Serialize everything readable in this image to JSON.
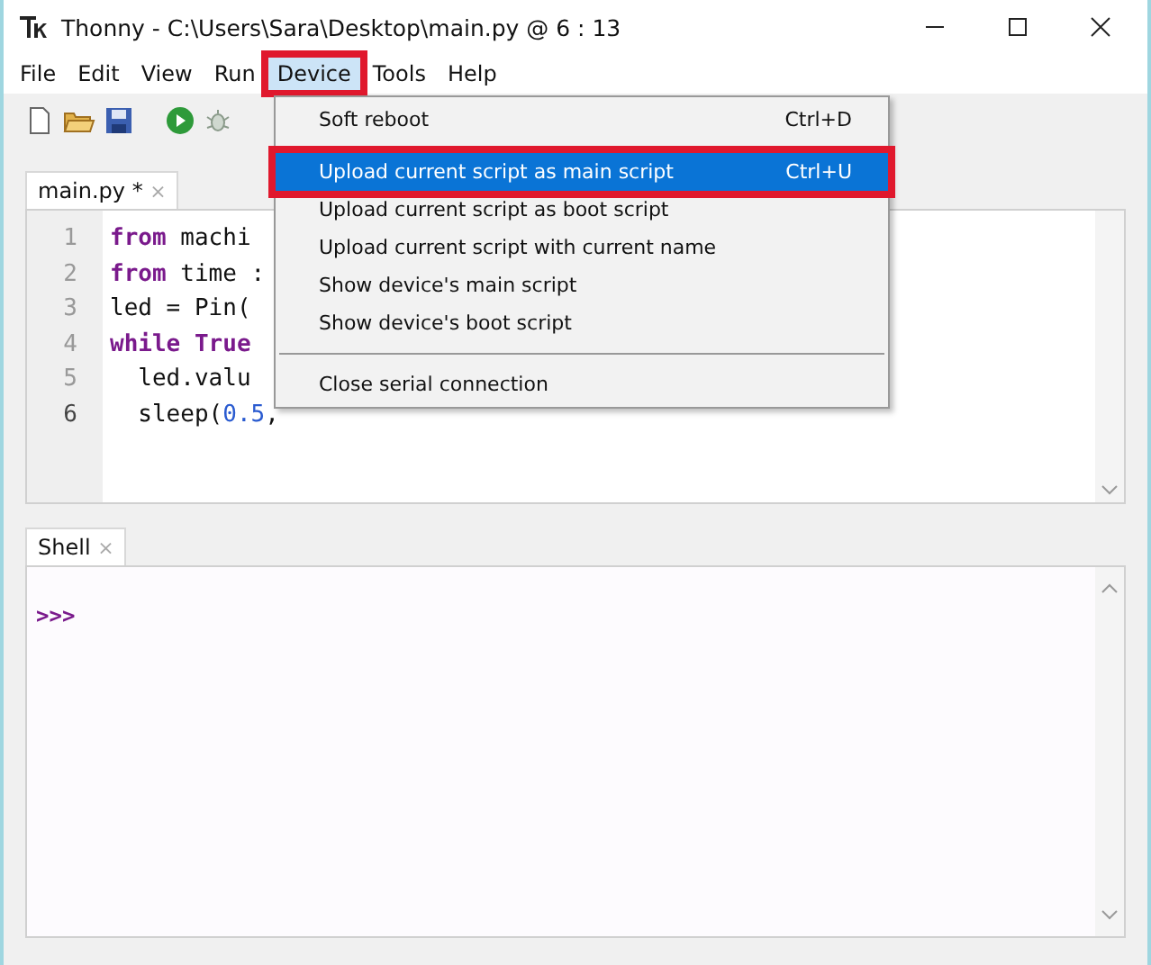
{
  "window": {
    "title": "Thonny  -  C:\\Users\\Sara\\Desktop\\main.py  @  6 : 13"
  },
  "menu_bar": [
    {
      "label": "File",
      "selected": false,
      "annotated": false
    },
    {
      "label": "Edit",
      "selected": false,
      "annotated": false
    },
    {
      "label": "View",
      "selected": false,
      "annotated": false
    },
    {
      "label": "Run",
      "selected": false,
      "annotated": false
    },
    {
      "label": "Device",
      "selected": true,
      "annotated": true
    },
    {
      "label": "Tools",
      "selected": false,
      "annotated": false
    },
    {
      "label": "Help",
      "selected": false,
      "annotated": false
    }
  ],
  "editor": {
    "tab": {
      "label": "main.py *",
      "close": "×"
    },
    "lines": [
      {
        "number": "1",
        "current": false,
        "tokens": [
          {
            "text": "from",
            "kind": "keyword"
          },
          {
            "text": " machi",
            "kind": "plain"
          }
        ]
      },
      {
        "number": "2",
        "current": false,
        "tokens": [
          {
            "text": "from",
            "kind": "keyword"
          },
          {
            "text": " time :",
            "kind": "plain"
          }
        ]
      },
      {
        "number": "3",
        "current": false,
        "tokens": [
          {
            "text": "led = Pin(",
            "kind": "plain"
          }
        ]
      },
      {
        "number": "4",
        "current": false,
        "tokens": [
          {
            "text": "while",
            "kind": "keyword"
          },
          {
            "text": " True",
            "kind": "keyword"
          }
        ]
      },
      {
        "number": "5",
        "current": false,
        "tokens": [
          {
            "text": "  led.valu",
            "kind": "plain"
          }
        ]
      },
      {
        "number": "6",
        "current": true,
        "tokens": [
          {
            "text": "  sleep(",
            "kind": "plain"
          },
          {
            "text": "0.5",
            "kind": "number"
          },
          {
            "text": ",",
            "kind": "plain"
          }
        ]
      }
    ]
  },
  "device_menu": [
    {
      "kind": "item",
      "label": "Soft reboot",
      "shortcut": "Ctrl+D",
      "selected": false,
      "annotated": false
    },
    {
      "kind": "item",
      "label": "Upload current script as main script",
      "shortcut": "Ctrl+U",
      "selected": true,
      "annotated": true
    },
    {
      "kind": "item",
      "label": "Upload current script as boot script",
      "selected": false,
      "annotated": false
    },
    {
      "kind": "item",
      "label": "Upload current script with current name",
      "selected": false,
      "annotated": false
    },
    {
      "kind": "item",
      "label": "Show device's main script",
      "selected": false,
      "annotated": false
    },
    {
      "kind": "item",
      "label": "Show device's boot script",
      "selected": false,
      "annotated": false
    },
    {
      "kind": "separator"
    },
    {
      "kind": "item",
      "label": "Close serial connection",
      "selected": false,
      "annotated": false
    }
  ],
  "shell": {
    "tab": {
      "label": "Shell",
      "close": "×"
    },
    "prompt": ">>>"
  }
}
